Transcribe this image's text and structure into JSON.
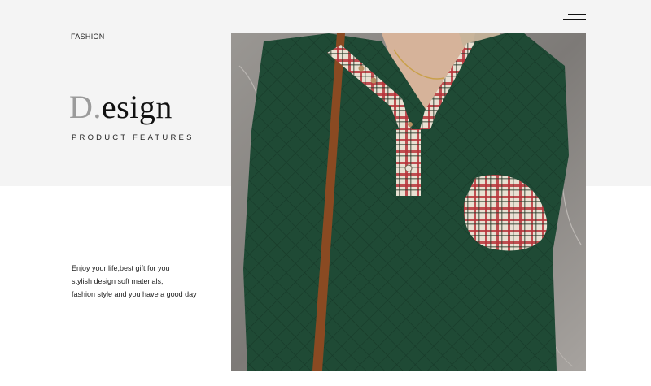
{
  "header": {
    "brand": "FASHION",
    "menu_icon": "menu-icon"
  },
  "hero": {
    "title_initial": "D.",
    "title_rest": "esign",
    "subtitle": "PRODUCT FEATURES"
  },
  "description": {
    "lines": [
      "Enjoy your life,best gift for you",
      "stylish design soft materials,",
      "fashion style and you have a good day"
    ]
  },
  "colors": {
    "band": "#f4f4f4",
    "garment": "#1f4a35",
    "plaid_red": "#b8343a",
    "plaid_cream": "#e9e0d2"
  }
}
